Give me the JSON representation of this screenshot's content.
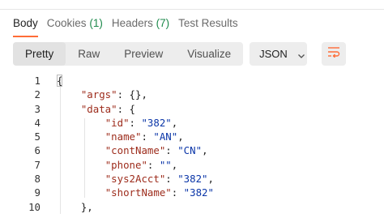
{
  "tabs": [
    {
      "label": "Body",
      "count": ""
    },
    {
      "label": "Cookies",
      "count": "(1)"
    },
    {
      "label": "Headers",
      "count": "(7)"
    },
    {
      "label": "Test Results",
      "count": ""
    }
  ],
  "view_modes": [
    "Pretty",
    "Raw",
    "Preview",
    "Visualize"
  ],
  "active_view_mode": "Pretty",
  "format": {
    "selected": "JSON",
    "icon": "chevron-down-icon"
  },
  "wrap_icon": "wrap-lines-icon",
  "accent_color": "#ff6c37",
  "count_color": "#1e8a4c",
  "code_lines": [
    {
      "num": "1",
      "text": "{"
    },
    {
      "num": "2",
      "text": "    \"args\": {},"
    },
    {
      "num": "3",
      "text": "    \"data\": {"
    },
    {
      "num": "4",
      "text": "        \"id\": \"382\","
    },
    {
      "num": "5",
      "text": "        \"name\": \"AN\","
    },
    {
      "num": "6",
      "text": "        \"contName\": \"CN\","
    },
    {
      "num": "7",
      "text": "        \"phone\": \"\","
    },
    {
      "num": "8",
      "text": "        \"sys2Acct\": \"382\","
    },
    {
      "num": "9",
      "text": "        \"shortName\": \"382\""
    },
    {
      "num": "10",
      "text": "    },"
    }
  ]
}
